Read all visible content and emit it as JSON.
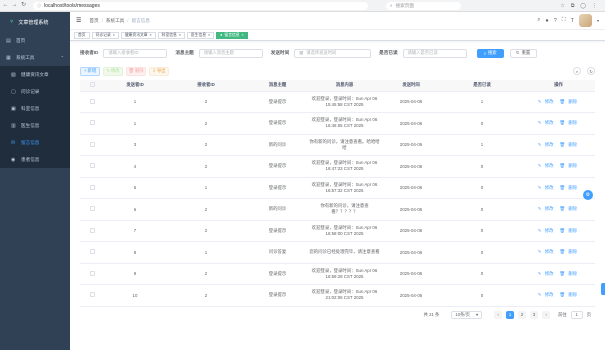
{
  "browser": {
    "url": "localhost/tools/messages",
    "search_placeholder": "搜索页面"
  },
  "sidebar": {
    "app_title": "文章管理系统",
    "items": [
      {
        "label": "首页",
        "icon": "home-icon"
      },
      {
        "label": "系统工具",
        "icon": "tools-icon"
      }
    ],
    "sub_items": [
      {
        "label": "健康资讯文章",
        "icon": "article-icon"
      },
      {
        "label": "问诊记录",
        "icon": "record-icon"
      },
      {
        "label": "科室信息",
        "icon": "dept-icon"
      },
      {
        "label": "医生信息",
        "icon": "doctor-icon"
      },
      {
        "label": "留言信息",
        "icon": "message-icon"
      },
      {
        "label": "患者信息",
        "icon": "patient-icon"
      }
    ]
  },
  "breadcrumb": [
    "首页",
    "系统工具",
    "留言信息"
  ],
  "tags": [
    {
      "label": "首页",
      "active": false
    },
    {
      "label": "问诊记录",
      "active": false
    },
    {
      "label": "健康资讯文章",
      "active": false
    },
    {
      "label": "科室信息",
      "active": false
    },
    {
      "label": "医生信息",
      "active": false
    },
    {
      "label": "留言信息",
      "active": true
    }
  ],
  "search": {
    "sender_label": "接收者ID",
    "sender_placeholder": "请输入接收者ID",
    "subject_label": "消息主题",
    "subject_placeholder": "请输入消息主题",
    "time_label": "发送时间",
    "time_placeholder": "请选择发送时间",
    "read_label": "是否已读",
    "read_placeholder": "请输入是否已读",
    "search_btn": "搜索",
    "reset_btn": "重置"
  },
  "toolbar": {
    "add": "+ 新增",
    "edit": "修改",
    "delete": "删除",
    "export": "导出"
  },
  "table": {
    "headers": [
      "",
      "发送者ID",
      "接收者ID",
      "消息主题",
      "消息内容",
      "发送时间",
      "是否已读",
      "操作"
    ],
    "rows": [
      {
        "sender": "1",
        "receiver": "2",
        "subject": "登录提示",
        "content": "欢迎登录，登录时间：Sun Apr 06 15:45:58 CST 2025",
        "time": "2025-04-06",
        "read": "1"
      },
      {
        "sender": "1",
        "receiver": "2",
        "subject": "登录提示",
        "content": "欢迎登录，登录时间：Sun Apr 06 16:46:55 CST 2025",
        "time": "2025-04-06",
        "read": "0"
      },
      {
        "sender": "3",
        "receiver": "2",
        "subject": "新的问诊",
        "content": "你有新的问诊，请注意查看。哈哈哈哈",
        "time": "2025-04-06",
        "read": "1"
      },
      {
        "sender": "4",
        "receiver": "2",
        "subject": "登录提示",
        "content": "欢迎登录，登录时间：Sun Apr 06 16:47:23 CST 2025",
        "time": "2025-04-06",
        "read": "0"
      },
      {
        "sender": "5",
        "receiver": "1",
        "subject": "登录提示",
        "content": "欢迎登录，登录时间：Sun Apr 06 16:57:32 CST 2025",
        "time": "2025-04-06",
        "read": "0"
      },
      {
        "sender": "6",
        "receiver": "2",
        "subject": "新的问诊",
        "content": "你有新的问诊，请注意查看？？？？？",
        "time": "2025-04-06",
        "read": "0"
      },
      {
        "sender": "7",
        "receiver": "2",
        "subject": "登录提示",
        "content": "欢迎登录，登录时间：Sun Apr 06 16:58:00 CST 2025",
        "time": "2025-04-06",
        "read": "0"
      },
      {
        "sender": "8",
        "receiver": "1",
        "subject": "问诊答复",
        "content": "您的问诊已经处理完毕，请注意查看",
        "time": "2025-04-06",
        "read": "0"
      },
      {
        "sender": "9",
        "receiver": "2",
        "subject": "登录提示",
        "content": "欢迎登录，登录时间：Sun Apr 06 16:59:28 CST 2025",
        "time": "2025-04-06",
        "read": "0"
      },
      {
        "sender": "10",
        "receiver": "2",
        "subject": "登录提示",
        "content": "欢迎登录，登录时间：Sun Apr 06 21:02:06 CST 2025",
        "time": "2025-04-06",
        "read": "0"
      }
    ],
    "op_edit": "修改",
    "op_delete": "删除"
  },
  "pagination": {
    "total": "共 21 条",
    "page_size": "10条/页",
    "pages": [
      "1",
      "2",
      "3"
    ],
    "current_page": "1",
    "goto_label": "前往",
    "goto_value": "1",
    "page_unit": "页"
  },
  "colors": {
    "primary": "#409eff",
    "sidebar_bg": "#304156",
    "active_tag": "#42b983"
  }
}
